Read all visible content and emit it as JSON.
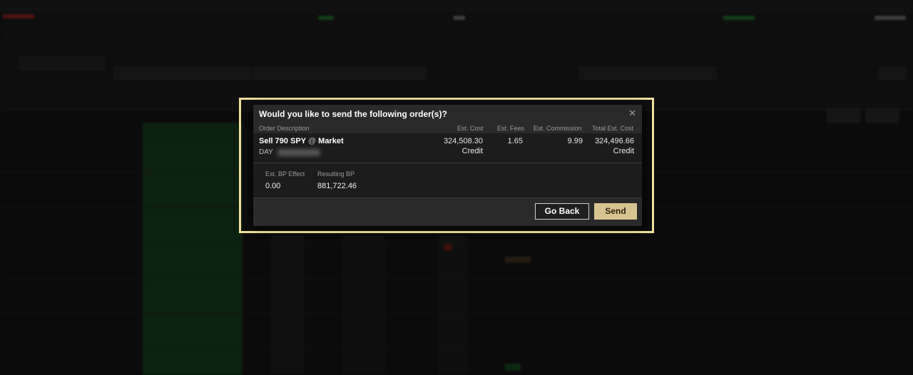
{
  "dialog": {
    "title": "Would you like to send the following order(s)?",
    "close_glyph": "✕",
    "columns": {
      "order_description": "Order Description",
      "est_cost": "Est. Cost",
      "est_fees": "Est. Fees",
      "est_commission": "Est. Commission",
      "total_est_cost": "Total Est. Cost"
    },
    "order": {
      "action_qty_symbol": "Sell 790 SPY",
      "at": "@",
      "order_type": "Market",
      "time_in_force": "DAY",
      "est_cost": "324,508.30",
      "est_cost_type": "Credit",
      "est_fees": "1.65",
      "est_commission": "9.99",
      "total_est_cost": "324,496.66",
      "total_est_cost_type": "Credit"
    },
    "bp": {
      "effect_label": "Est. BP Effect",
      "effect_value": "0.00",
      "resulting_label": "Resulting BP",
      "resulting_value": "881,722.46"
    },
    "buttons": {
      "go_back": "Go Back",
      "send": "Send"
    }
  },
  "colors": {
    "highlight": "#efe19a",
    "send_button": "#d8c490",
    "ladder_bid": "#14331a"
  }
}
